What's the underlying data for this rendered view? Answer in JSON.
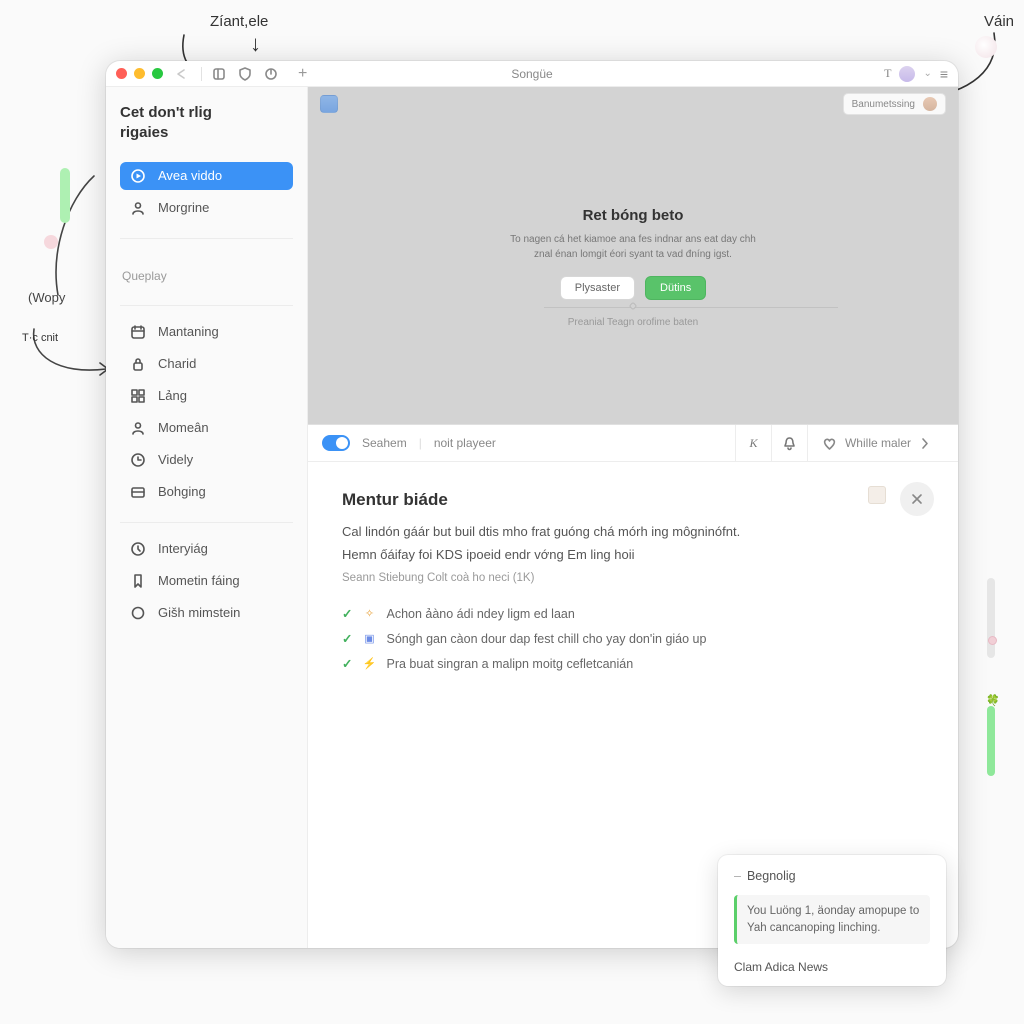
{
  "annotations": {
    "top_left": "Zíant,ele",
    "top_right": "Váin",
    "left_paren": "(Wopy",
    "tc": "T·c\ncnit"
  },
  "titlebar": {
    "title": "Songüe",
    "glyph_T": "T",
    "caret": "⌄",
    "menu_glyph": "≡"
  },
  "sidebar": {
    "title_line1": "Cet don't rlig",
    "title_line2": "rigaies",
    "primary": [
      {
        "label": "Avea viddo"
      },
      {
        "label": "Morgrine"
      }
    ],
    "group_label": "Queplay",
    "items": [
      {
        "label": "Mantaning"
      },
      {
        "label": "Charid"
      },
      {
        "label": "Lảng"
      },
      {
        "label": "Momeân"
      },
      {
        "label": "Videly"
      },
      {
        "label": "Bohging"
      }
    ],
    "footer": [
      {
        "label": "Interyiág"
      },
      {
        "label": "Mometin fáing"
      },
      {
        "label": "Gišh mimstein"
      }
    ]
  },
  "hero": {
    "pill": "Banumetssing",
    "heading": "Ret bóng beto",
    "subtext": "To nagen cá het kiamoe ana fes indnar ans eat day chh znal énan lomgit éori syant ta vad đníng igst.",
    "btn_secondary": "Plysaster",
    "btn_primary": "Dütins",
    "footnote": "Preanial Teagn orofime baten"
  },
  "strip": {
    "label_a": "Seahem",
    "label_b": "noit playeer",
    "glyph_k": "K",
    "right_label": "Whille maler"
  },
  "content": {
    "heading": "Mentur biáde",
    "lead1": "Cal lindón gáár but buil dtis mho frat guóng chá mórh ing môgninófnt.",
    "lead2": "Hemn ốáifay foi KDS ipoeid endr vớng Em ling hoii",
    "byline": "Seann Stiebung Colt coà ho neci (1K)",
    "checks": [
      {
        "icon": "a",
        "text": "Achon ảàno ádi ndey ligm ed laan"
      },
      {
        "icon": "b",
        "text": "Sóngh gan càon dour dap fest chill cho yay don'in giáo up"
      },
      {
        "icon": "c",
        "text": "Pra buat singran a malipn moitg cefletcanián"
      }
    ]
  },
  "popup": {
    "heading": "Begnolig",
    "message": "You Luöng 1, äonday amopupe to Yah cancanoping linching.",
    "link": "Clam Adica News"
  }
}
